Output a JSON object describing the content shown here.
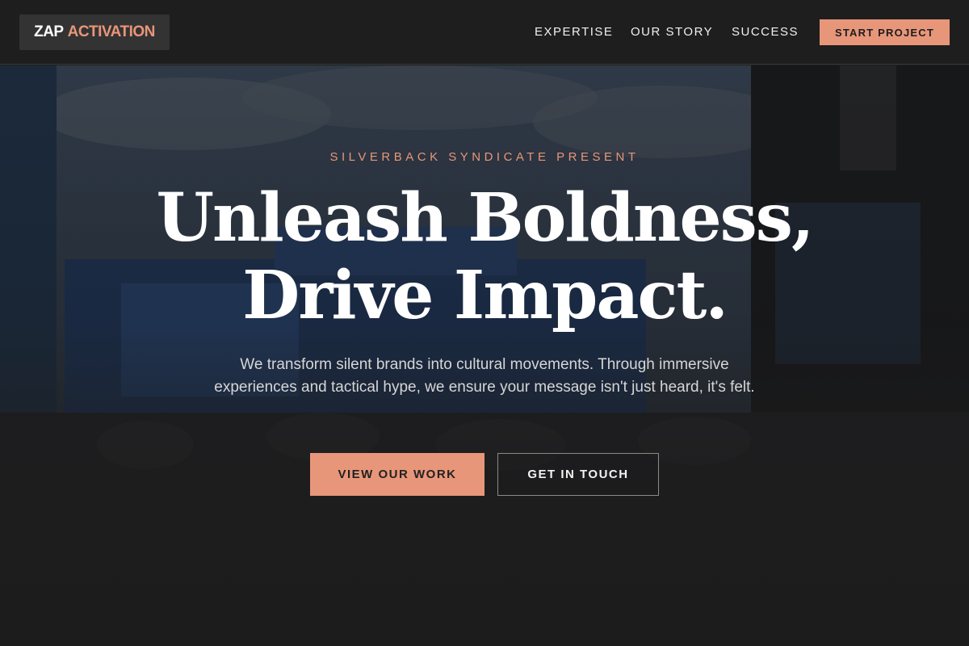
{
  "brand": {
    "part1": "ZAP",
    "part2": "ACTIVATION"
  },
  "nav": {
    "items": [
      "EXPERTISE",
      "OUR STORY",
      "SUCCESS"
    ],
    "cta_label": "START PROJECT"
  },
  "hero": {
    "eyebrow": "SILVERBACK SYNDICATE PRESENT",
    "headline_line1": "Unleash Boldness,",
    "headline_line2": "Drive Impact.",
    "subtext": "We transform silent brands into cultural movements. Through immersive experiences and tactical hype, we ensure your message isn't just heard, it's felt.",
    "primary_button": "VIEW OUR WORK",
    "secondary_button": "GET IN TOUCH"
  },
  "colors": {
    "accent": "#e8967a",
    "background": "#1c1c1c",
    "header": "#1e1e1e"
  }
}
